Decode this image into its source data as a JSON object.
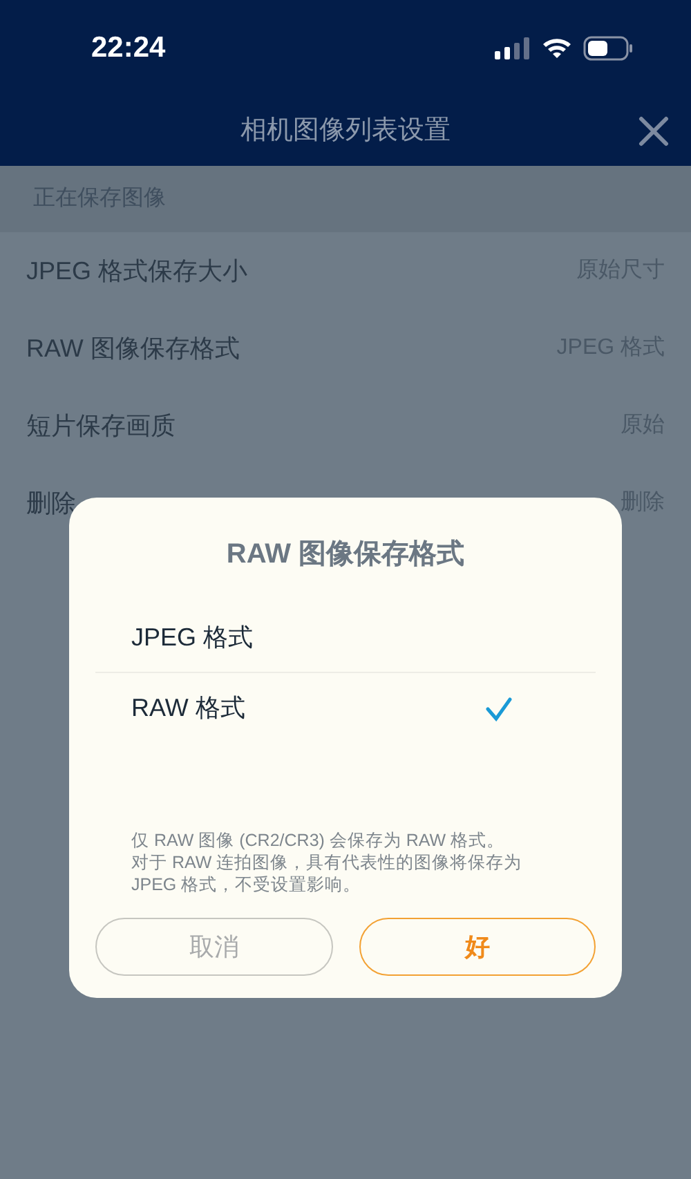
{
  "status_bar": {
    "time": "22:24"
  },
  "header": {
    "title": "相机图像列表设置"
  },
  "section": {
    "title": "正在保存图像"
  },
  "settings": [
    {
      "label": "JPEG 格式保存大小",
      "value": "原始尺寸"
    },
    {
      "label": "RAW 图像保存格式",
      "value": "JPEG 格式"
    },
    {
      "label": "短片保存画质",
      "value": "原始"
    },
    {
      "label": "删除",
      "value": "删除"
    }
  ],
  "dialog": {
    "title": "RAW 图像保存格式",
    "options": [
      {
        "label": "JPEG 格式",
        "selected": false
      },
      {
        "label": "RAW 格式",
        "selected": true
      }
    ],
    "notes": [
      "仅 RAW 图像 (CR2/CR3) 会保存为 RAW 格式。",
      "对于 RAW 连拍图像，具有代表性的图像将保存为 JPEG 格式，不受设置影响。"
    ],
    "cancel": "取消",
    "ok": "好"
  }
}
